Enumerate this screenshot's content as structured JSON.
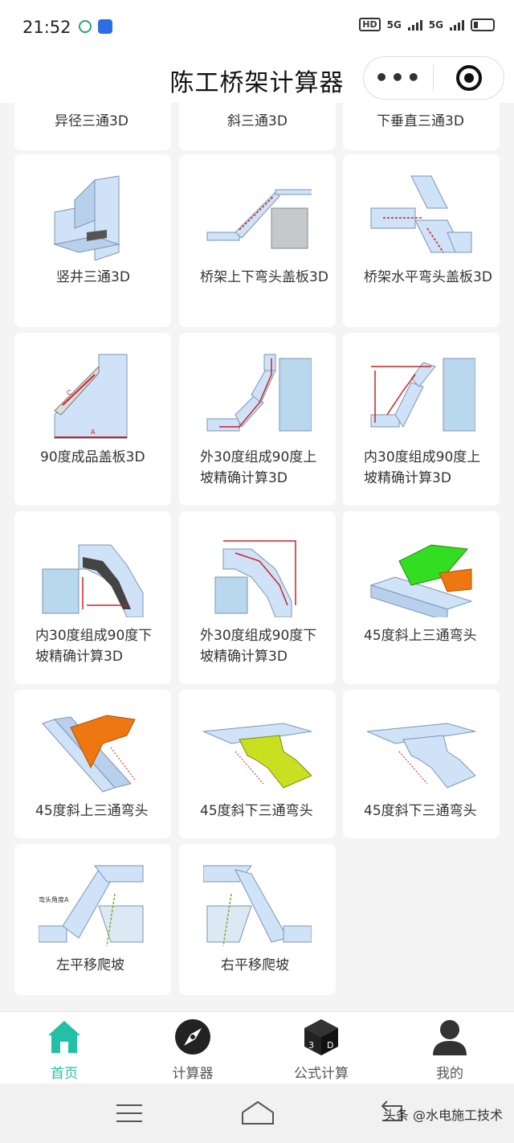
{
  "status": {
    "time": "21:52",
    "hd": "HD",
    "net1": "5G",
    "net2": "5G"
  },
  "header": {
    "title": "陈工桥架计算器",
    "more_icon": "more-dots-icon",
    "close_icon": "target-close-icon"
  },
  "items": [
    {
      "label": "异径三通3D",
      "icon": "reducing-tee-3d"
    },
    {
      "label": "斜三通3D",
      "icon": "oblique-tee-3d"
    },
    {
      "label": "下垂直三通3D",
      "icon": "vertical-down-tee-3d"
    },
    {
      "label": "竖井三通3D",
      "icon": "shaft-tee-3d"
    },
    {
      "label": "桥架上下弯头盖板3D",
      "icon": "vertical-elbow-cover"
    },
    {
      "label": "桥架水平弯头盖板3D",
      "icon": "horizontal-elbow-cover"
    },
    {
      "label": "90度成品盖板3D",
      "icon": "elbow-90-cover"
    },
    {
      "label": "外30度组成90度上坡精确计算3D",
      "icon": "outer-30-up"
    },
    {
      "label": "内30度组成90度上坡精确计算3D",
      "icon": "inner-30-up"
    },
    {
      "label": "内30度组成90度下坡精确计算3D",
      "icon": "inner-30-down"
    },
    {
      "label": "外30度组成90度下坡精确计算3D",
      "icon": "outer-30-down"
    },
    {
      "label": "45度斜上三通弯头",
      "icon": "tee-45-up-green"
    },
    {
      "label": "45度斜上三通弯头",
      "icon": "tee-45-up-orange"
    },
    {
      "label": "45度斜下三通弯头",
      "icon": "tee-45-down-yellow"
    },
    {
      "label": "45度斜下三通弯头",
      "icon": "tee-45-down-gray"
    },
    {
      "label": "左平移爬坡",
      "icon": "left-shift-slope"
    },
    {
      "label": "右平移爬坡",
      "icon": "right-shift-slope"
    }
  ],
  "tabs": [
    {
      "label": "首页",
      "icon": "home-icon",
      "active": true
    },
    {
      "label": "计算器",
      "icon": "compass-icon",
      "active": false
    },
    {
      "label": "公式计算",
      "icon": "cube-3d-icon",
      "active": false
    },
    {
      "label": "我的",
      "icon": "user-icon",
      "active": false
    }
  ],
  "system_nav": {
    "watermark": "头条 @水电施工技术"
  },
  "colors": {
    "accent": "#22c1a5",
    "panel": "#cfe2f7",
    "green": "#33dd22",
    "orange": "#ee7711",
    "yellow": "#c8e020"
  }
}
